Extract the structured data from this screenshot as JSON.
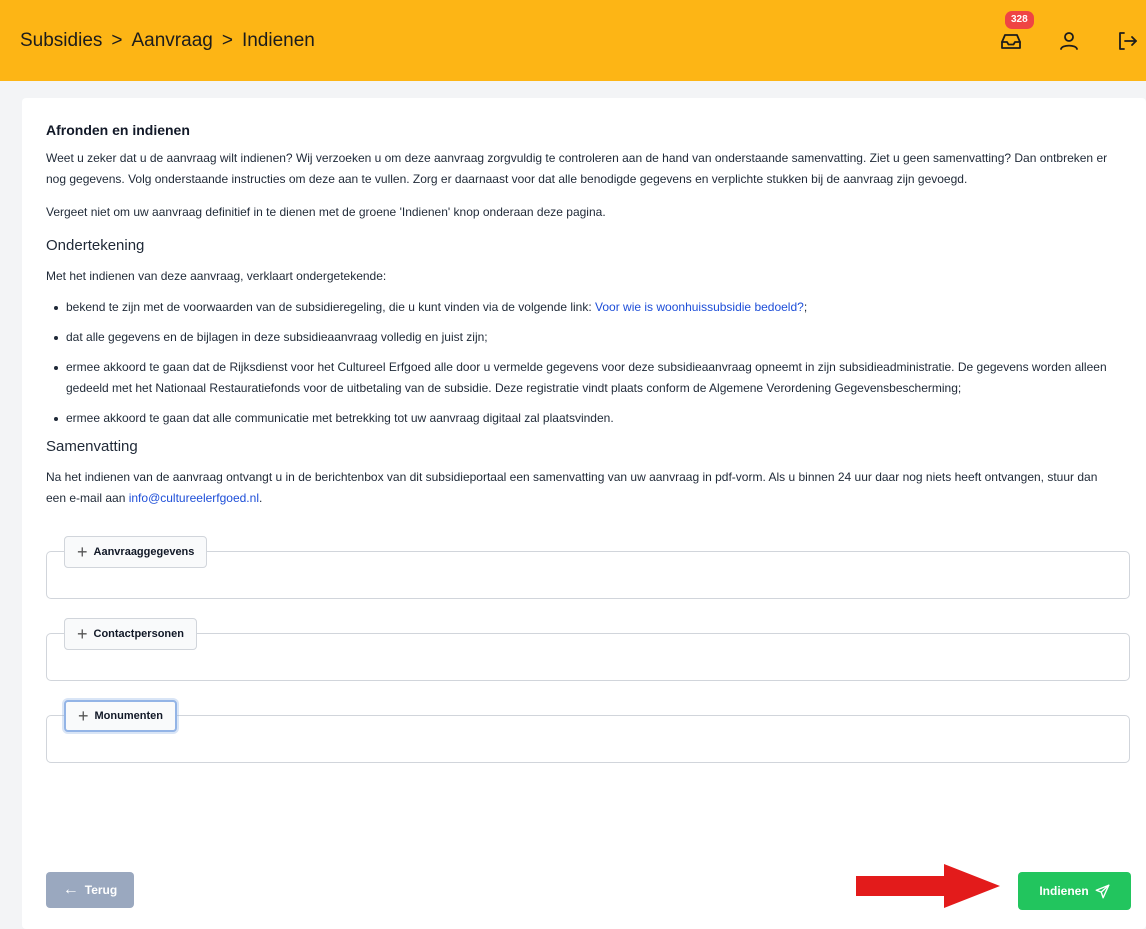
{
  "header": {
    "breadcrumb": [
      "Subsidies",
      "Aanvraag",
      "Indienen"
    ],
    "separator": ">",
    "inbox_count": "328"
  },
  "main": {
    "title": "Afronden en indienen",
    "intro": "Weet u zeker dat u de aanvraag wilt indienen? Wij verzoeken u om deze aanvraag zorgvuldig te controleren aan de hand van onderstaande samenvatting. Ziet u geen samenvatting? Dan ontbreken er nog gegevens. Volg onderstaande instructies om deze aan te vullen. Zorg er daarnaast voor dat alle benodigde gegevens en verplichte stukken bij de aanvraag zijn gevoegd.",
    "reminder": "Vergeet niet om uw aanvraag definitief in te dienen met de groene 'Indienen' knop onderaan deze pagina.",
    "signing": {
      "title": "Ondertekening",
      "intro": "Met het indienen van deze aanvraag, verklaart ondergetekende:",
      "item1_prefix": "bekend te zijn met de voorwaarden van de subsidieregeling, die u kunt vinden via de volgende link: ",
      "item1_link": "Voor wie is woonhuissubsidie bedoeld?",
      "item1_suffix": ";",
      "item2": "dat alle gegevens en de bijlagen in deze subsidieaanvraag volledig en juist zijn;",
      "item3": "ermee akkoord te gaan dat de Rijksdienst voor het Cultureel Erfgoed alle door u vermelde gegevens voor deze subsidieaanvraag opneemt in zijn subsidieadministratie. De gegevens worden alleen gedeeld met het Nationaal Restauratiefonds voor de uitbetaling van de subsidie. Deze registratie vindt plaats conform de Algemene Verordening Gegevensbescherming;",
      "item4": "ermee akkoord te gaan dat alle communicatie met betrekking tot uw aanvraag digitaal zal plaatsvinden."
    },
    "summary": {
      "title": "Samenvatting",
      "text_prefix": "Na het indienen van de aanvraag ontvangt u in de berichtenbox van dit subsidieportaal een samenvatting van uw aanvraag in pdf-vorm. Als u binnen 24 uur daar nog niets heeft ontvangen, stuur dan een e-mail aan ",
      "email": "info@cultureelerfgoed.nl",
      "text_suffix": "."
    },
    "sections": [
      "Aanvraaggegevens",
      "Contactpersonen",
      "Monumenten"
    ]
  },
  "footer": {
    "back_label": "Terug",
    "submit_label": "Indienen"
  },
  "colors": {
    "header_bg": "#fdb515",
    "submit_bg": "#22c55e",
    "back_bg": "#9aa8bf",
    "badge_bg": "#ef4444",
    "link": "#1d4ed8",
    "annotation_arrow": "#e31b1b"
  }
}
